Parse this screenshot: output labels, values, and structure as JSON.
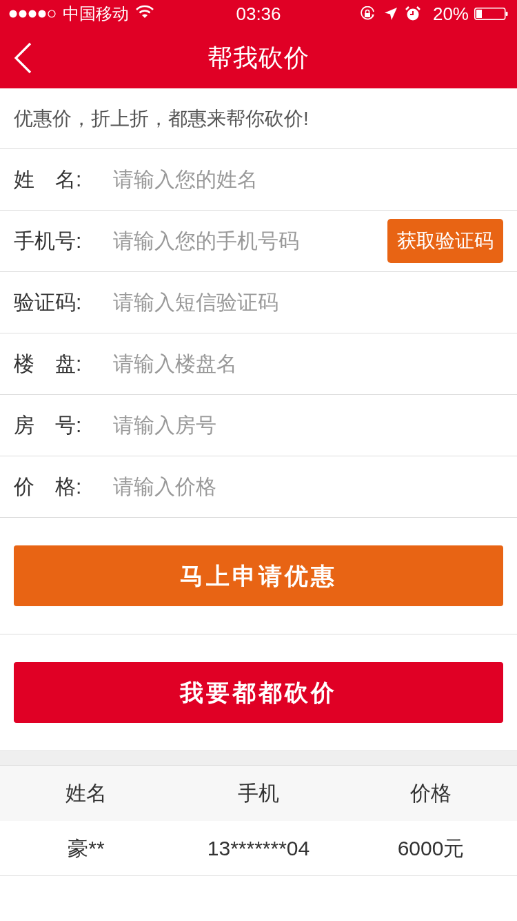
{
  "status_bar": {
    "carrier": "中国移动",
    "time": "03:36",
    "battery_percent": "20%"
  },
  "nav_bar": {
    "title": "帮我砍价"
  },
  "intro": "优惠价，折上折，都惠来帮你砍价!",
  "form": {
    "fields": [
      {
        "label": "姓　名:",
        "placeholder": "请输入您的姓名"
      },
      {
        "label": "手机号:",
        "placeholder": "请输入您的手机号码",
        "button": "获取验证码"
      },
      {
        "label": "验证码:",
        "placeholder": "请输入短信验证码"
      },
      {
        "label": "楼　盘:",
        "placeholder": "请输入楼盘名"
      },
      {
        "label": "房　号:",
        "placeholder": "请输入房号"
      },
      {
        "label": "价　格:",
        "placeholder": "请输入价格"
      }
    ]
  },
  "buttons": [
    {
      "label": "马上申请优惠",
      "color": "#e86414"
    },
    {
      "label": "我要都都砍价",
      "color": "#e00025"
    }
  ],
  "table": {
    "columns": [
      "姓名",
      "手机",
      "价格"
    ],
    "rows": [
      [
        "豪**",
        "13*******04",
        "6000元"
      ]
    ]
  }
}
